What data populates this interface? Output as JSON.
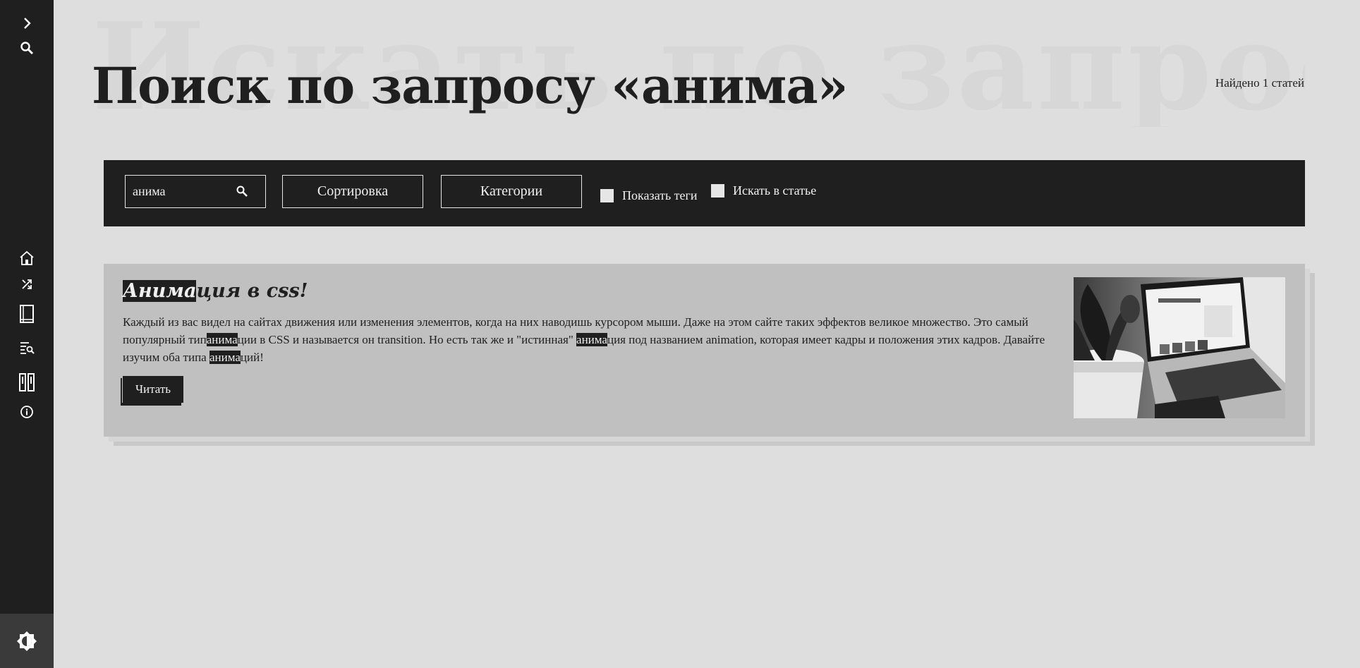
{
  "sidebar": {
    "items": [
      {
        "icon": "chevron-right-icon"
      },
      {
        "icon": "search-icon"
      },
      {
        "icon": "home-icon"
      },
      {
        "icon": "shuffle-icon"
      },
      {
        "icon": "book-icon"
      },
      {
        "icon": "search-list-icon"
      },
      {
        "icon": "library-icon"
      },
      {
        "icon": "info-icon"
      }
    ],
    "theme_icon": "theme-toggle-icon"
  },
  "header": {
    "title": "Поиск по запросу «анима»",
    "background_word": "Искать по запрос",
    "found_count": "Найдено 1 статей"
  },
  "filters": {
    "search_value": "анима",
    "sort_label": "Сортировка",
    "categories_label": "Категории",
    "show_tags_label": "Показать теги",
    "search_in_article_label": "Искать в статье"
  },
  "article": {
    "title_highlight": "Анима",
    "title_rest": "ция в css!",
    "text_part1": "Каждый из вас видел на сайтах движения или изменения элементов, когда на них наводишь курсором мыши. Даже на этом сайте таких эффектов великое множество. Это самый популярный тип",
    "text_hl1": "анима",
    "text_part2": "ции в CSS и называется он transition. Но есть так же и \"истинная\" ",
    "text_hl2": "анима",
    "text_part3": "ция под названием animation, которая имеет кадры и положения этих кадров. Давайте изучим оба типа ",
    "text_hl3": "анима",
    "text_part4": "ций!",
    "read_label": "Читать"
  },
  "colors": {
    "dark": "#1f1f1f",
    "background": "#dedede",
    "card": "#c0c0c0"
  }
}
